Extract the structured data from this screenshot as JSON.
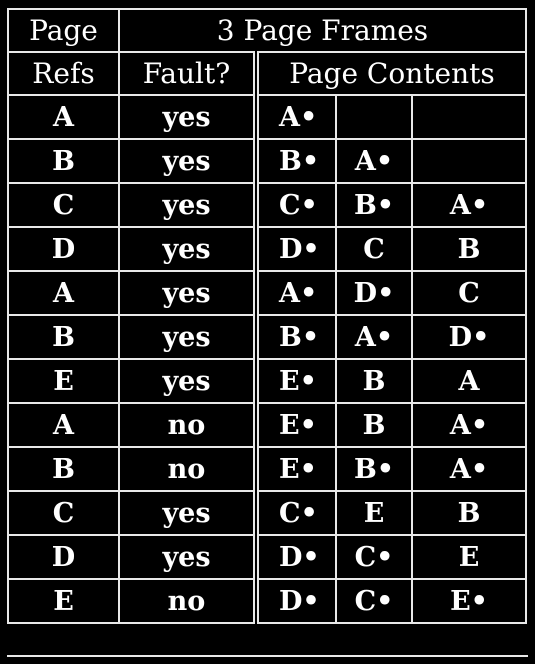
{
  "header": {
    "refs_label_1": "Page",
    "refs_label_2": "Refs",
    "frames_label": "3 Page Frames",
    "fault_label": "Fault?",
    "contents_label": "Page Contents"
  },
  "rows": [
    {
      "ref": "A",
      "fault": "yes",
      "frames": [
        "A•",
        "",
        ""
      ]
    },
    {
      "ref": "B",
      "fault": "yes",
      "frames": [
        "B•",
        "A•",
        ""
      ]
    },
    {
      "ref": "C",
      "fault": "yes",
      "frames": [
        "C•",
        "B•",
        "A•"
      ]
    },
    {
      "ref": "D",
      "fault": "yes",
      "frames": [
        "D•",
        "C",
        "B"
      ]
    },
    {
      "ref": "A",
      "fault": "yes",
      "frames": [
        "A•",
        "D•",
        "C"
      ]
    },
    {
      "ref": "B",
      "fault": "yes",
      "frames": [
        "B•",
        "A•",
        "D•"
      ]
    },
    {
      "ref": "E",
      "fault": "yes",
      "frames": [
        "E•",
        "B",
        "A"
      ]
    },
    {
      "ref": "A",
      "fault": "no",
      "frames": [
        "E•",
        "B",
        "A•"
      ]
    },
    {
      "ref": "B",
      "fault": "no",
      "frames": [
        "E•",
        "B•",
        "A•"
      ]
    },
    {
      "ref": "C",
      "fault": "yes",
      "frames": [
        "C•",
        "E",
        "B"
      ]
    },
    {
      "ref": "D",
      "fault": "yes",
      "frames": [
        "D•",
        "C•",
        "E"
      ]
    },
    {
      "ref": "E",
      "fault": "no",
      "frames": [
        "D•",
        "C•",
        "E•"
      ]
    }
  ]
}
